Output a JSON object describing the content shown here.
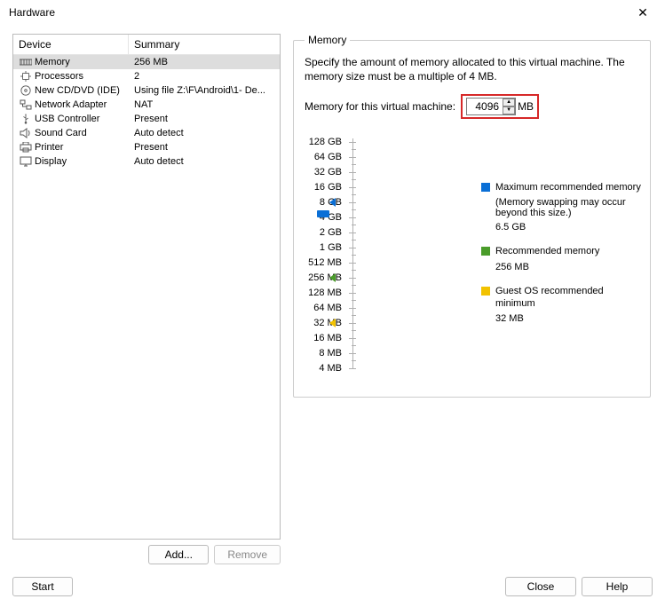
{
  "window": {
    "title": "Hardware"
  },
  "table": {
    "headers": {
      "device": "Device",
      "summary": "Summary"
    },
    "rows": [
      {
        "name": "Memory",
        "summary": "256 MB",
        "icon": "memory-icon",
        "selected": true
      },
      {
        "name": "Processors",
        "summary": "2",
        "icon": "cpu-icon"
      },
      {
        "name": "New CD/DVD (IDE)",
        "summary": "Using file Z:\\F\\Android\\1- De...",
        "icon": "cd-icon"
      },
      {
        "name": "Network Adapter",
        "summary": "NAT",
        "icon": "network-icon"
      },
      {
        "name": "USB Controller",
        "summary": "Present",
        "icon": "usb-icon"
      },
      {
        "name": "Sound Card",
        "summary": "Auto detect",
        "icon": "sound-icon"
      },
      {
        "name": "Printer",
        "summary": "Present",
        "icon": "printer-icon"
      },
      {
        "name": "Display",
        "summary": "Auto detect",
        "icon": "display-icon"
      }
    ]
  },
  "left_buttons": {
    "add": "Add...",
    "remove": "Remove"
  },
  "memory": {
    "group_label": "Memory",
    "description": "Specify the amount of memory allocated to this virtual machine. The memory size must be a multiple of 4 MB.",
    "input_label": "Memory for this virtual machine:",
    "value": "4096",
    "unit": "MB",
    "scale": [
      "128 GB",
      "64 GB",
      "32 GB",
      "16 GB",
      "8 GB",
      "4 GB",
      "2 GB",
      "1 GB",
      "512 MB",
      "256 MB",
      "128 MB",
      "64 MB",
      "32 MB",
      "16 MB",
      "8 MB",
      "4 MB"
    ],
    "legend": {
      "max": {
        "title": "Maximum recommended memory",
        "sub": "(Memory swapping may occur beyond this size.)",
        "value": "6.5 GB",
        "color": "#0a6fd6"
      },
      "rec": {
        "title": "Recommended memory",
        "value": "256 MB",
        "color": "#4a9c2a"
      },
      "min": {
        "title": "Guest OS recommended minimum",
        "value": "32 MB",
        "color": "#f2c200"
      }
    }
  },
  "bottom": {
    "start": "Start",
    "close": "Close",
    "help": "Help"
  }
}
